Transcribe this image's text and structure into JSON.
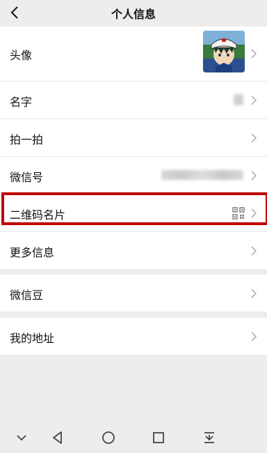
{
  "header": {
    "title": "个人信息",
    "back_icon": "back-chevron-icon"
  },
  "profile": [
    {
      "label": "头像"
    },
    {
      "label": "名字"
    },
    {
      "label": "拍一拍"
    },
    {
      "label": "微信号"
    },
    {
      "label": "二维码名片"
    },
    {
      "label": "更多信息"
    }
  ],
  "wallet": [
    {
      "label": "微信豆"
    }
  ],
  "address": [
    {
      "label": "我的地址"
    }
  ],
  "colors": {
    "highlight": "#c00000",
    "background": "#ededed"
  },
  "navbar": {
    "icons": [
      "collapse-down-icon",
      "back-triangle-icon",
      "home-circle-icon",
      "recents-square-icon",
      "notification-pull-icon"
    ]
  }
}
